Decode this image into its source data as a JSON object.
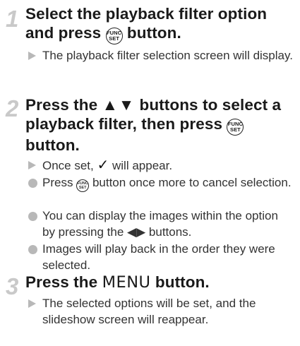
{
  "step1": {
    "number": "1",
    "title_a": "Select the playback filter option",
    "title_b": "and press",
    "title_c": "button.",
    "items": [
      {
        "type": "result",
        "text": "The playback filter selection screen will display."
      }
    ]
  },
  "step2": {
    "number": "2",
    "title_a": "Press the",
    "title_arrows": "▲▼",
    "title_b": "buttons to select a playback filter, then press",
    "title_c": "button.",
    "items": [
      {
        "type": "result",
        "text_a": "Once set,",
        "glyph": "✓",
        "text_b": "will appear."
      },
      {
        "type": "note",
        "text_a": "Press",
        "text_b": "button once more to cancel selection."
      },
      {
        "type": "note",
        "text_a": "You can display the images within the option by pressing the",
        "glyph": "◀▶",
        "text_b": "buttons."
      },
      {
        "type": "note",
        "text": "Images will play back in the order they were selected."
      }
    ]
  },
  "step3": {
    "number": "3",
    "title_a": "Press the",
    "title_menu": "MENU",
    "title_b": "button.",
    "items": [
      {
        "type": "result",
        "text": "The selected options will be set, and the slideshow screen will reappear."
      }
    ]
  },
  "func_icon": {
    "top": "FUNC",
    "bottom": "SET"
  },
  "icons": {
    "result": "triangle-bullet-icon",
    "note": "circle-bullet-icon",
    "func": "func-set-button-icon",
    "check": "checkmark-icon"
  },
  "colors": {
    "step_number": "#c9c9c9",
    "bullet": "#b8b8b8",
    "text": "#1a1a1a"
  }
}
